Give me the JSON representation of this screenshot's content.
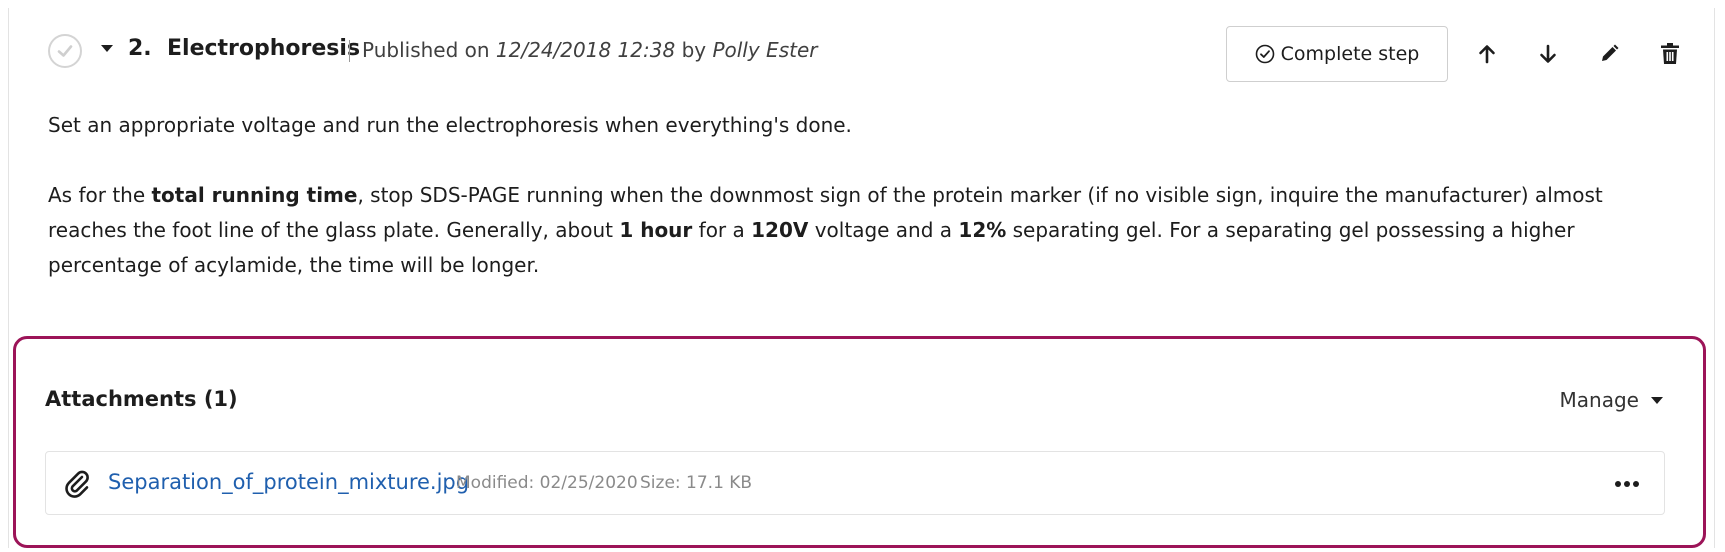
{
  "step": {
    "number": "2.",
    "title": "Electrophoresis",
    "published_prefix": "Published on",
    "published_date": "12/24/2018 12:38",
    "by_label": "by",
    "author": "Polly Ester"
  },
  "toolbar": {
    "complete_label": "Complete step",
    "icons": [
      "move-up-icon",
      "move-down-icon",
      "edit-icon",
      "delete-icon"
    ]
  },
  "body": {
    "para1": "Set an appropriate voltage and run the electrophoresis when everything's done.",
    "p2_a": "As for the ",
    "p2_b": "total running time",
    "p2_c": ", stop SDS-PAGE running when the downmost sign of the protein marker (if no visible sign, inquire the manufacturer) almost reaches the foot line of the glass plate. Generally, about ",
    "p2_d": "1 hour",
    "p2_e": " for a ",
    "p2_f": "120V",
    "p2_g": " voltage and a ",
    "p2_h": "12%",
    "p2_i": " separating gel. For a separating gel possessing a higher percentage of acylamide, the time will be longer."
  },
  "attachments": {
    "title": "Attachments (1)",
    "manage_label": "Manage",
    "files": [
      {
        "name": "Separation_of_protein_mixture.jpg",
        "modified": "Modified: 02/25/2020",
        "size": "Size: 17.1 KB"
      }
    ]
  },
  "colors": {
    "accent_border": "#9c1458",
    "link": "#1f5fae"
  }
}
